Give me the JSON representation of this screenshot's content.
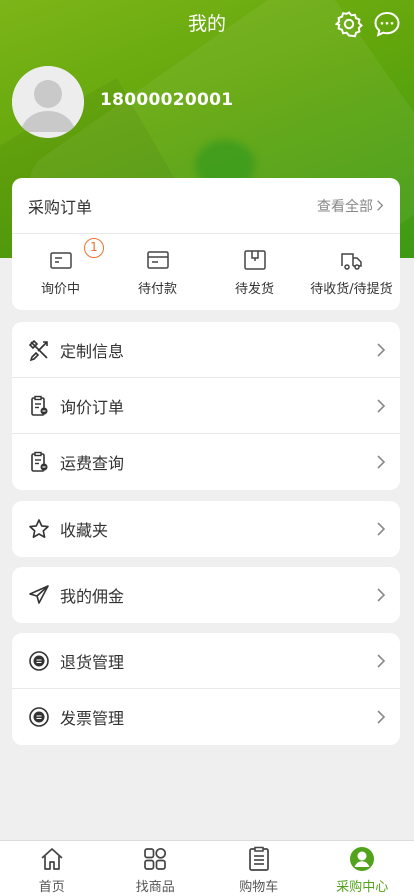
{
  "header": {
    "title": "我的",
    "settings_icon": "gear-icon",
    "message_icon": "chat-bubble-icon"
  },
  "profile": {
    "phone": "18000020001",
    "avatar_icon": "default-avatar-icon"
  },
  "orders": {
    "title": "采购订单",
    "view_all": "查看全部",
    "statuses": [
      {
        "label": "询价中",
        "icon": "inquiry-icon",
        "badge": "1"
      },
      {
        "label": "待付款",
        "icon": "card-icon"
      },
      {
        "label": "待发货",
        "icon": "box-icon"
      },
      {
        "label": "待收货/待提货",
        "icon": "truck-icon"
      }
    ]
  },
  "menu_groups": [
    {
      "items": [
        {
          "label": "定制信息",
          "icon": "tools-icon"
        },
        {
          "label": "询价订单",
          "icon": "clipboard-icon"
        },
        {
          "label": "运费查询",
          "icon": "clipboard-icon"
        }
      ]
    },
    {
      "items": [
        {
          "label": "收藏夹",
          "icon": "star-icon"
        }
      ]
    },
    {
      "items": [
        {
          "label": "我的佣金",
          "icon": "paper-plane-icon"
        }
      ]
    },
    {
      "items": [
        {
          "label": "退货管理",
          "icon": "coin-icon"
        },
        {
          "label": "发票管理",
          "icon": "coin-icon"
        }
      ]
    }
  ],
  "tabbar": {
    "items": [
      {
        "label": "首页",
        "icon": "home-icon"
      },
      {
        "label": "找商品",
        "icon": "grid-icon"
      },
      {
        "label": "购物车",
        "icon": "list-icon"
      },
      {
        "label": "采购中心",
        "icon": "user-icon",
        "active": true
      }
    ]
  },
  "colors": {
    "brand_green": "#62a60c",
    "active_tab": "#52a31c",
    "badge_orange": "#f07030"
  }
}
